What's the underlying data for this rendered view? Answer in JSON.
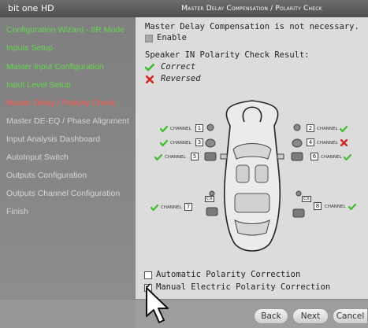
{
  "sidebar": {
    "brand": "bit one HD",
    "items": [
      {
        "label": "Configuration Wizard - IIR Mode",
        "state": "done"
      },
      {
        "label": "Inputs Setup",
        "state": "done"
      },
      {
        "label": "Master Input Configuration",
        "state": "done"
      },
      {
        "label": "Input Level Setup",
        "state": "done"
      },
      {
        "label": "Master Delay / Polarity Check",
        "state": "current"
      },
      {
        "label": "Master DE-EQ / Phase Alignment",
        "state": "todo"
      },
      {
        "label": "Input Analysis Dashboard",
        "state": "todo"
      },
      {
        "label": "AutoInput Switch",
        "state": "todo"
      },
      {
        "label": "Outputs Configuration",
        "state": "todo"
      },
      {
        "label": "Outputs Channel Configuration",
        "state": "todo"
      },
      {
        "label": "Finish",
        "state": "todo"
      }
    ],
    "colors": {
      "done": "#63d84e",
      "current": "#ff5a4e",
      "todo": "#d5d5d5"
    }
  },
  "main": {
    "title": "Master Delay Compensation / Polarity Check",
    "delay_msg": "Master Delay Compensation is not necessary.",
    "enable_label": "Enable",
    "polarity_heading": "Speaker IN Polarity Check Result:",
    "legend": {
      "correct": "Correct",
      "reversed": "Reversed"
    },
    "channel_word": "CHANNEL",
    "channels": [
      {
        "num": "1",
        "status": "correct"
      },
      {
        "num": "2",
        "status": "correct"
      },
      {
        "num": "3",
        "status": "correct"
      },
      {
        "num": "4",
        "status": "reversed"
      },
      {
        "num": "5",
        "status": "correct"
      },
      {
        "num": "6",
        "status": "correct"
      },
      {
        "num": "7",
        "status": "correct"
      },
      {
        "num": "8",
        "status": "correct"
      }
    ],
    "speaker_cx": "CX",
    "auto_correction_label": "Automatic Polarity Correction",
    "manual_correction_label": "Manual Electric Polarity Correction",
    "auto_correction_checked": false,
    "manual_correction_checked": true
  },
  "buttons": {
    "back": "Back",
    "next": "Next",
    "cancel": "Cancel"
  },
  "icons": {
    "correct": "green-check-icon",
    "reversed": "red-x-icon",
    "cursor": "mouse-pointer-icon"
  }
}
